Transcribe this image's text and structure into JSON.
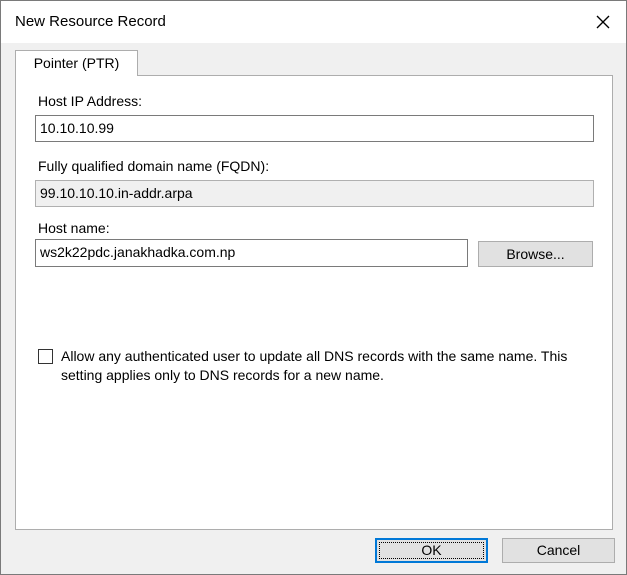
{
  "window": {
    "title": "New Resource Record",
    "close_icon": "close-icon"
  },
  "tab": {
    "label": "Pointer (PTR)"
  },
  "form": {
    "host_ip_label": "Host IP Address:",
    "host_ip_value": "10.10.10.99",
    "fqdn_label": "Fully qualified domain name (FQDN):",
    "fqdn_value": "99.10.10.10.in-addr.arpa",
    "host_name_label": "Host name:",
    "host_name_value": "ws2k22pdc.janakhadka.com.np",
    "browse_label": "Browse...",
    "allow_update_text": "Allow any authenticated user to update all DNS records with the same name. This setting applies only to DNS records for a new name.",
    "allow_update_checked": false
  },
  "buttons": {
    "ok_label": "OK",
    "cancel_label": "Cancel"
  },
  "colors": {
    "accent": "#0078d7",
    "dialog_bg": "#f0f0f0",
    "panel_bg": "#ffffff"
  }
}
